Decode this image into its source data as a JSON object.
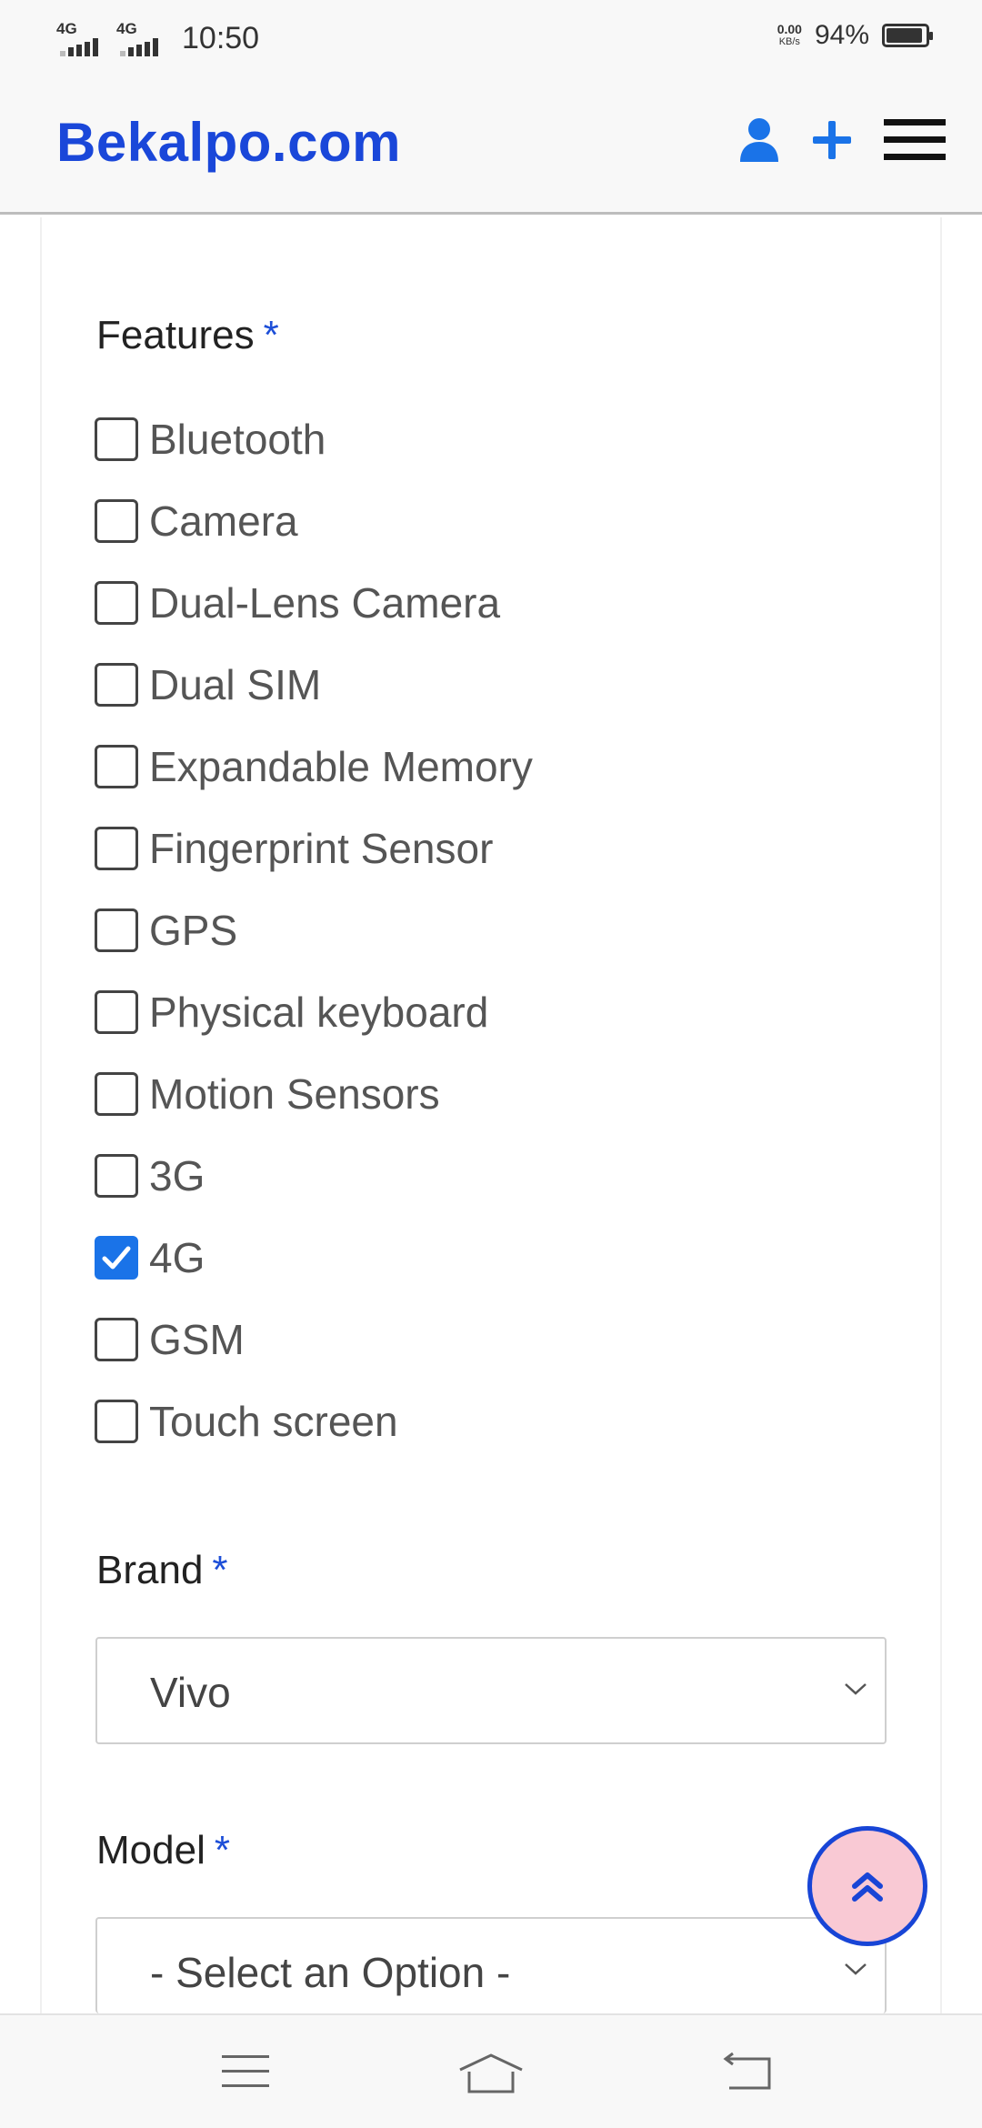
{
  "status_bar": {
    "network_1": "4G",
    "network_2": "4G",
    "time": "10:50",
    "data_rate": "0.00",
    "data_rate_unit": "KB/s",
    "battery_percent_text": "94%",
    "battery_level": 0.94
  },
  "header": {
    "logo": "Bekalpo.com",
    "icons": [
      "user-icon",
      "plus-icon",
      "hamburger-menu-icon"
    ],
    "accent_color": "#1a73e8",
    "logo_color": "#1a47d9"
  },
  "form": {
    "features": {
      "label": "Features",
      "required_mark": "*",
      "options": [
        {
          "label": "Bluetooth",
          "checked": false
        },
        {
          "label": "Camera",
          "checked": false
        },
        {
          "label": "Dual-Lens Camera",
          "checked": false
        },
        {
          "label": "Dual SIM",
          "checked": false
        },
        {
          "label": "Expandable Memory",
          "checked": false
        },
        {
          "label": "Fingerprint Sensor",
          "checked": false
        },
        {
          "label": "GPS",
          "checked": false
        },
        {
          "label": "Physical keyboard",
          "checked": false
        },
        {
          "label": "Motion Sensors",
          "checked": false
        },
        {
          "label": "3G",
          "checked": false
        },
        {
          "label": "4G",
          "checked": true
        },
        {
          "label": "GSM",
          "checked": false
        },
        {
          "label": "Touch screen",
          "checked": false
        }
      ]
    },
    "brand": {
      "label": "Brand",
      "required_mark": "*",
      "selected": "Vivo"
    },
    "model": {
      "label": "Model",
      "required_mark": "*",
      "selected": "- Select an Option -"
    }
  },
  "fab": {
    "icon": "double-chevron-up-icon",
    "color": "#1845d6",
    "fill": "#f9c9d4"
  },
  "nav_bar": {
    "icons": [
      "menu-icon",
      "home-icon",
      "back-icon"
    ]
  }
}
